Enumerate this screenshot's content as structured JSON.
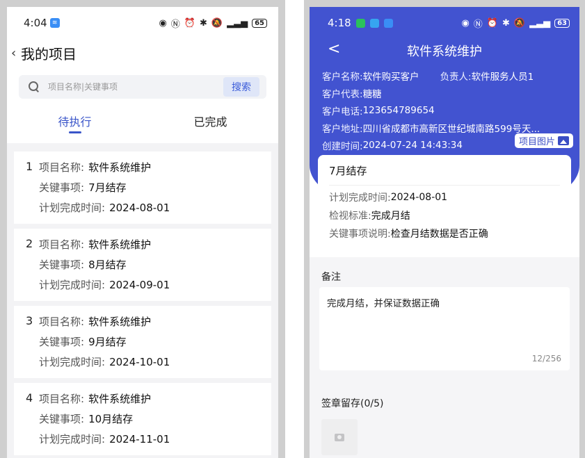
{
  "left": {
    "status": {
      "time": "4:04",
      "battery": "65"
    },
    "header": {
      "back": "‹",
      "title": "我的项目"
    },
    "search": {
      "placeholder": "项目名称|关键事项",
      "button": "搜索"
    },
    "tabs": [
      {
        "label": "待执行",
        "active": true
      },
      {
        "label": "已完成",
        "active": false
      }
    ],
    "tasks": [
      {
        "index": "1",
        "name_label": "项目名称:",
        "name": "软件系统维护",
        "key_label": "关键事项:",
        "key": "7月结存",
        "date_label": "计划完成时间:",
        "date": "2024-08-01"
      },
      {
        "index": "2",
        "name_label": "项目名称:",
        "name": "软件系统维护",
        "key_label": "关键事项:",
        "key": "8月结存",
        "date_label": "计划完成时间:",
        "date": "2024-09-01"
      },
      {
        "index": "3",
        "name_label": "项目名称:",
        "name": "软件系统维护",
        "key_label": "关键事项:",
        "key": "9月结存",
        "date_label": "计划完成时间:",
        "date": "2024-10-01"
      },
      {
        "index": "4",
        "name_label": "项目名称:",
        "name": "软件系统维护",
        "key_label": "关键事项:",
        "key": "10月结存",
        "date_label": "计划完成时间:",
        "date": "2024-11-01"
      }
    ]
  },
  "right": {
    "status": {
      "time": "4:18",
      "battery": "63"
    },
    "header": {
      "back": "<",
      "title": "软件系统维护"
    },
    "info": {
      "customer_name_label": "客户名称:",
      "customer_name": "软件购买客户",
      "owner_label": "负责人:",
      "owner": "软件服务人员1",
      "rep_label": "客户代表:",
      "rep": "糖糖",
      "phone_label": "客户电话:",
      "phone": "123654789654",
      "address_label": "客户地址:",
      "address": "四川省成都市高新区世纪城南路599号天...",
      "created_label": "创建时间:",
      "created": "2024-07-24 14:43:34",
      "image_button": "项目图片"
    },
    "detail": {
      "title": "7月结存",
      "plan_label": "计划完成时间:",
      "plan": "2024-08-01",
      "standard_label": "检视标准:",
      "standard": "完成月结",
      "desc_label": "关键事项说明:",
      "desc": "检查月结数据是否正确"
    },
    "remarks": {
      "label": "备注",
      "value": "完成月结，并保证数据正确",
      "count": "12/256"
    },
    "stamp": {
      "label": "签章留存(0/5)"
    }
  },
  "colors": {
    "accent": "#3a55c9",
    "hero": "#4253d0"
  },
  "icons": [
    "wifi-icon",
    "eye-icon",
    "nfc-icon",
    "alarm-icon",
    "bluetooth-icon",
    "mute-icon",
    "signal-icon",
    "battery-icon",
    "search-icon",
    "chevron-left-icon",
    "image-icon",
    "camera-icon",
    "wechat-icon"
  ]
}
